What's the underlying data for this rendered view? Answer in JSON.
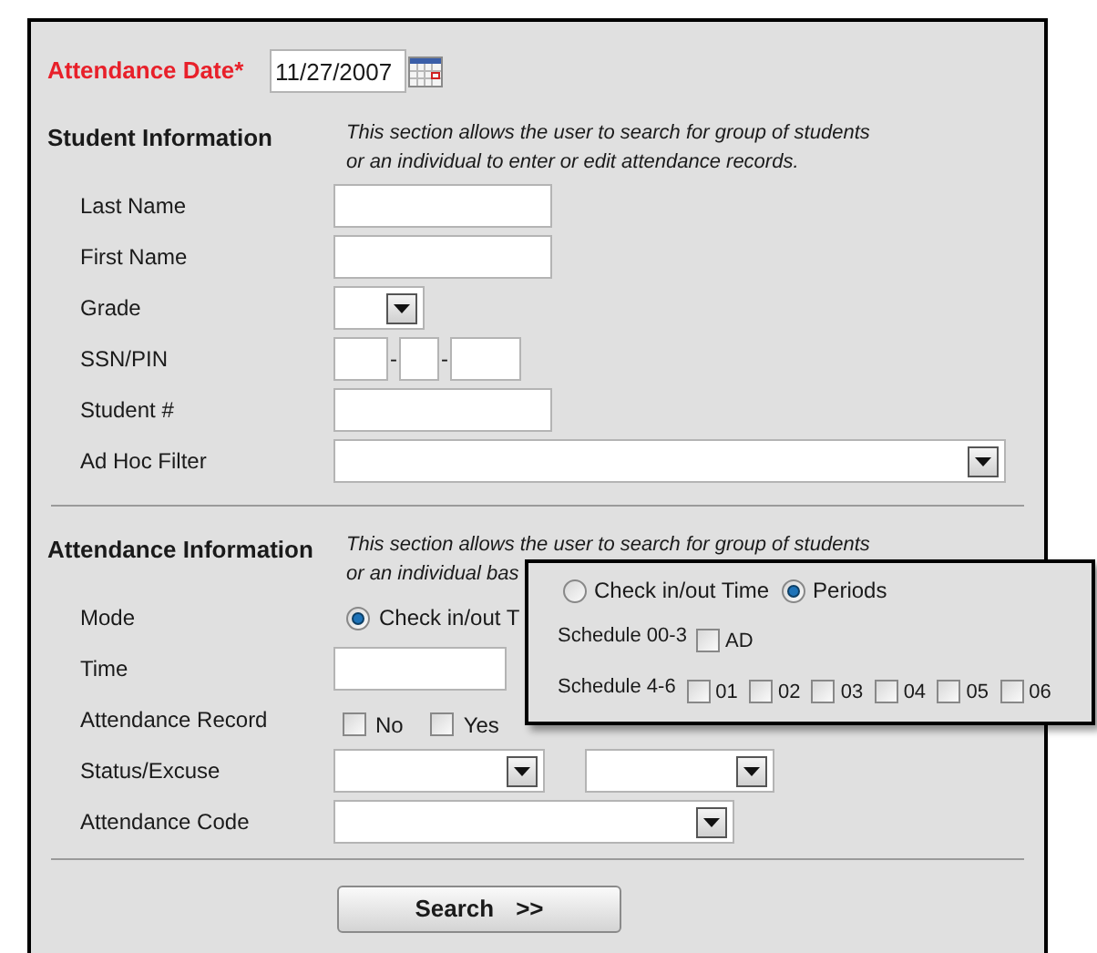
{
  "attendance_date": {
    "label": "Attendance Date",
    "required_mark": "*",
    "value": "11/27/2007"
  },
  "student_information": {
    "heading": "Student Information",
    "description_lines": [
      "This section allows the user to search for group of students",
      "or an individual to enter or edit attendance records."
    ],
    "fields": [
      {
        "kind": "text",
        "label": "Last Name"
      },
      {
        "kind": "text",
        "label": "First Name"
      },
      {
        "kind": "small-select",
        "label": "Grade"
      },
      {
        "kind": "ssn",
        "label": "SSN/PIN",
        "separators": [
          "-",
          "-"
        ]
      },
      {
        "kind": "text",
        "label": "Student #"
      },
      {
        "kind": "wide-select",
        "label": "Ad Hoc Filter"
      }
    ]
  },
  "attendance_information": {
    "heading": "Attendance Information",
    "description_lines": [
      "This section allows the user to search for group of students",
      "or an individual bas"
    ],
    "fields": [
      {
        "kind": "radios",
        "label": "Mode",
        "options": [
          {
            "label": "Check in/out T",
            "selected": true
          }
        ]
      },
      {
        "kind": "short-text",
        "label": "Time"
      },
      {
        "kind": "checkboxes",
        "label": "Attendance Record",
        "options": [
          {
            "label": "No",
            "checked": false
          },
          {
            "label": "Yes",
            "checked": false
          }
        ]
      },
      {
        "kind": "select-pair",
        "label": "Status/Excuse"
      },
      {
        "kind": "medium-select",
        "label": "Attendance Code"
      }
    ]
  },
  "search_button": {
    "label": "Search",
    "arrows": ">>"
  },
  "mode_popup": {
    "options": [
      {
        "label": "Check in/out Time",
        "selected": false
      },
      {
        "label": "Periods",
        "selected": true
      }
    ],
    "schedules": [
      {
        "label": "Schedule 00-3",
        "periods": [
          {
            "label": "AD",
            "checked": false
          }
        ]
      },
      {
        "label": "Schedule 4-6",
        "periods": [
          {
            "label": "01",
            "checked": false
          },
          {
            "label": "02",
            "checked": false
          },
          {
            "label": "03",
            "checked": false
          },
          {
            "label": "04",
            "checked": false
          },
          {
            "label": "05",
            "checked": false
          },
          {
            "label": "06",
            "checked": false
          }
        ]
      }
    ]
  }
}
